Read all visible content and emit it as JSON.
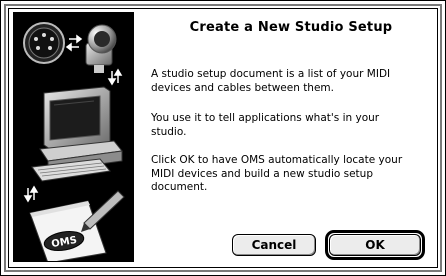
{
  "dialog": {
    "title": "Create a New Studio Setup",
    "paragraphs": [
      "A studio setup document is a list of your MIDI\ndevices and cables between them.",
      "You use it to tell applications what's in your\nstudio.",
      "Click OK to have OMS automatically locate your\nMIDI devices and build a new studio setup\ndocument."
    ],
    "buttons": {
      "cancel": "Cancel",
      "ok": "OK"
    },
    "art": {
      "logo_text": "OMS",
      "icons": [
        "midi-connector-icon",
        "arrows-icon",
        "computer-icon",
        "document-icon"
      ]
    }
  }
}
